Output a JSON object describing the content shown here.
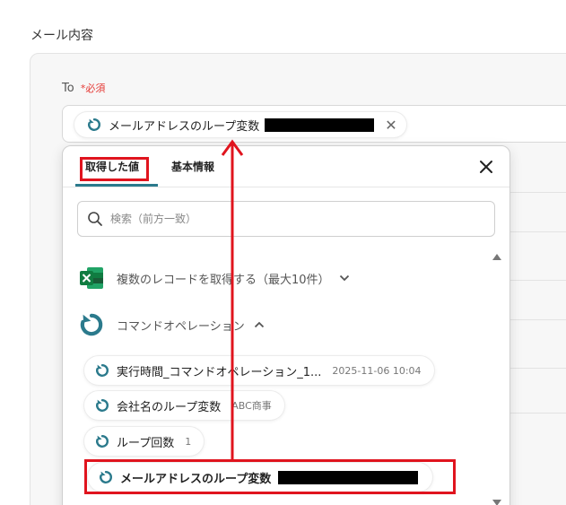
{
  "section": {
    "title": "メール内容"
  },
  "to_field": {
    "label": "To",
    "required_mark": "*",
    "required_text": "必須",
    "chip_label": "メールアドレスのループ変数",
    "remove_icon": "close-icon",
    "chip_icon": "loop-icon"
  },
  "panel": {
    "tabs": [
      {
        "label": "取得した値",
        "active": true
      },
      {
        "label": "基本情報",
        "active": false
      }
    ],
    "close_icon": "close-icon",
    "search": {
      "placeholder": "検索（前方一致）",
      "value": "",
      "icon": "search-icon"
    },
    "groups": [
      {
        "label": "複数のレコードを取得する（最大10件）",
        "icon": "excel-icon",
        "expanded": false
      },
      {
        "label": "コマンドオペレーション",
        "icon": "loop-icon",
        "expanded": true
      }
    ],
    "items": [
      {
        "label": "実行時間_コマンドオペレーション_1...",
        "value": "2025-11-06 10:04"
      },
      {
        "label": "会社名のループ変数",
        "value": "ABC商事"
      },
      {
        "label": "ループ回数",
        "value": "1"
      },
      {
        "label": "メールアドレスのループ変数",
        "value": ""
      }
    ]
  },
  "colors": {
    "accent": "#2b7a8c",
    "highlight": "#e0141e",
    "required": "#e53935",
    "excel": "#1d7044"
  }
}
